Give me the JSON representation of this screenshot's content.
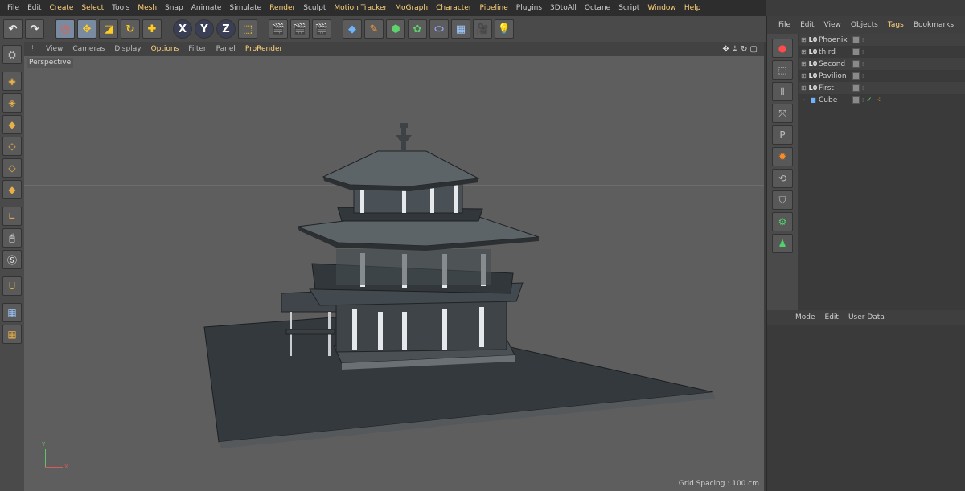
{
  "menubar": {
    "items": [
      {
        "label": "File",
        "hl": false
      },
      {
        "label": "Edit",
        "hl": false
      },
      {
        "label": "Create",
        "hl": true
      },
      {
        "label": "Select",
        "hl": true
      },
      {
        "label": "Tools",
        "hl": false
      },
      {
        "label": "Mesh",
        "hl": true
      },
      {
        "label": "Snap",
        "hl": false
      },
      {
        "label": "Animate",
        "hl": false
      },
      {
        "label": "Simulate",
        "hl": false
      },
      {
        "label": "Render",
        "hl": true
      },
      {
        "label": "Sculpt",
        "hl": false
      },
      {
        "label": "Motion Tracker",
        "hl": true
      },
      {
        "label": "MoGraph",
        "hl": true
      },
      {
        "label": "Character",
        "hl": true
      },
      {
        "label": "Pipeline",
        "hl": true
      },
      {
        "label": "Plugins",
        "hl": false
      },
      {
        "label": "3DtoAll",
        "hl": false
      },
      {
        "label": "Octane",
        "hl": false
      },
      {
        "label": "Script",
        "hl": false
      },
      {
        "label": "Window",
        "hl": true
      },
      {
        "label": "Help",
        "hl": true
      }
    ]
  },
  "toolbar": {
    "undo": "↶",
    "redo": "↷",
    "axis_x": "X",
    "axis_y": "Y",
    "axis_z": "Z"
  },
  "viewport": {
    "menu": [
      {
        "label": "View",
        "hl": false
      },
      {
        "label": "Cameras",
        "hl": false
      },
      {
        "label": "Display",
        "hl": false
      },
      {
        "label": "Options",
        "hl": true
      },
      {
        "label": "Filter",
        "hl": false
      },
      {
        "label": "Panel",
        "hl": false
      },
      {
        "label": "ProRender",
        "hl": true
      }
    ],
    "camera_label": "Perspective",
    "grid_spacing": "Grid Spacing : 100 cm",
    "axis_y_label": "Y",
    "axis_x_label": "X"
  },
  "object_manager": {
    "menu": [
      {
        "label": "File",
        "hl": false
      },
      {
        "label": "Edit",
        "hl": false
      },
      {
        "label": "View",
        "hl": false
      },
      {
        "label": "Objects",
        "hl": false
      },
      {
        "label": "Tags",
        "hl": true
      },
      {
        "label": "Bookmarks",
        "hl": false
      }
    ],
    "objects": [
      {
        "name": "Phoenix",
        "icon": "L0",
        "type": "null"
      },
      {
        "name": "third",
        "icon": "L0",
        "type": "null"
      },
      {
        "name": "Second",
        "icon": "L0",
        "type": "null"
      },
      {
        "name": "Pavilion",
        "icon": "L0",
        "type": "null"
      },
      {
        "name": "First",
        "icon": "L0",
        "type": "null"
      },
      {
        "name": "Cube",
        "icon": "■",
        "type": "cube"
      }
    ]
  },
  "attribute_manager": {
    "menu": [
      "Mode",
      "Edit",
      "User Data"
    ]
  },
  "colors": {
    "accent_yellow": "#ffd27a",
    "viewport_bg": "#5e5e5e",
    "model_dark": "#34393d"
  }
}
